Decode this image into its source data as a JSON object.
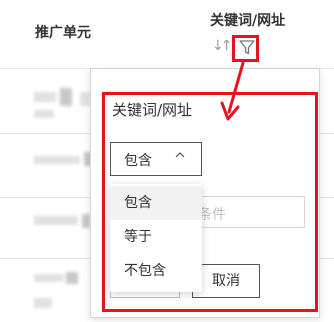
{
  "table": {
    "headers": {
      "unit": "推广单元",
      "keyword": "关键词/网址"
    }
  },
  "filter_popover": {
    "title": "关键词/网址",
    "match_select": {
      "value": "包含",
      "options": [
        "包含",
        "等于",
        "不包含"
      ]
    },
    "condition_input": {
      "placeholder_visible_fragment": "条件"
    },
    "cancel_label": "取消"
  },
  "colors": {
    "annotation": "#e8121b"
  }
}
